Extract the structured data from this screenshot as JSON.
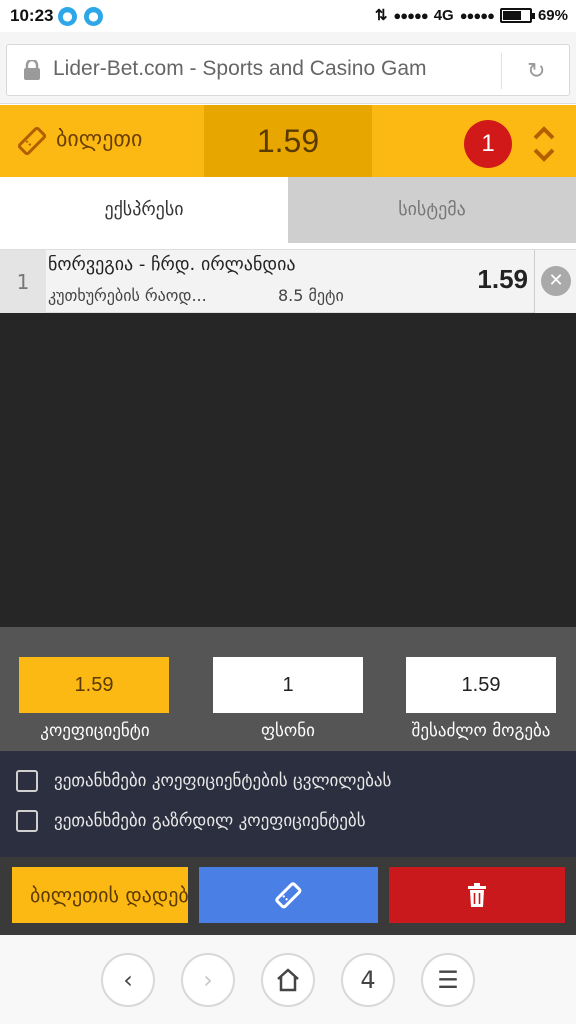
{
  "status": {
    "time": "10:23",
    "network": "4G",
    "battery": "69%",
    "battery_level": 0.69
  },
  "browser": {
    "url": "Lider-Bet.com - Sports and Casino Gam"
  },
  "ticket": {
    "title": "ბილეთი",
    "total_odds": "1.59",
    "count": "1"
  },
  "tabs": [
    {
      "label": "ექსპრესი"
    },
    {
      "label": "სისტემა"
    }
  ],
  "bets": [
    {
      "index": "1",
      "match": "ნორვეგია - ჩრდ. ირლანდია",
      "market": "კუთხურების რაოდ...",
      "pick": "8.5 მეტი",
      "odds": "1.59"
    }
  ],
  "summary": {
    "coefficient_value": "1.59",
    "coefficient_label": "კოეფიციენტი",
    "stake_value": "1",
    "stake_label": "ფსონი",
    "possible_win_value": "1.59",
    "possible_win_label": "შესაძლო მოგება"
  },
  "agreements": [
    {
      "label": "ვეთანხმები კოეფიციენტების ცვლილებას"
    },
    {
      "label": "ვეთანხმები გაზრდილ კოეფიციენტებს"
    }
  ],
  "actions": {
    "place_label": "ბილეთის დადება"
  },
  "nav": {
    "tabs_count": "4"
  },
  "colors": {
    "brand_yellow": "#fdb913",
    "odds_dark_yellow": "#e7a700",
    "badge_red": "#d11919",
    "action_blue": "#4a7fe6",
    "action_red": "#c9191c"
  },
  "icons": [
    "notification-icon",
    "lock-icon",
    "reload-icon",
    "ticket-icon",
    "expand-collapse-icon",
    "close-icon",
    "ticket-icon",
    "trash-icon",
    "back-icon",
    "forward-icon",
    "home-icon",
    "menu-icon"
  ]
}
